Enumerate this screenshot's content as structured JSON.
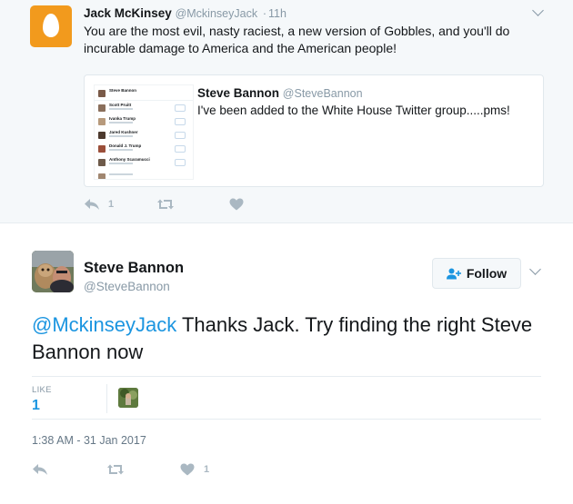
{
  "parent_tweet": {
    "name": "Jack McKinsey",
    "handle": "@MckinseyJack",
    "separator": "·",
    "time": "11h",
    "text": "You are the most evil, nasty raciest, a new version of Gobbles, and you'll do incurable damage to America and the American people!",
    "avatar_color": "#f29a1d",
    "quoted": {
      "name": "Steve Bannon",
      "handle": "@SteveBannon",
      "text": "I've been added to the White House Twitter group.....pms!",
      "thumbnail_rows": [
        {
          "name": "Steve Bannon"
        },
        {
          "name": "Scott Pruitt"
        },
        {
          "name": "Ivanka Trump"
        },
        {
          "name": "Jared Kushner"
        },
        {
          "name": "Donald J. Trump"
        },
        {
          "name": "Anthony Scaramucci"
        }
      ]
    },
    "actions": {
      "reply_icon": "reply-icon",
      "reply_count": "1",
      "retweet_icon": "retweet-icon",
      "like_icon": "heart-icon"
    }
  },
  "main_tweet": {
    "name": "Steve Bannon",
    "handle": "@SteveBannon",
    "follow_label": "Follow",
    "mention": "@MckinseyJack",
    "text": " Thanks Jack. Try finding the right Steve Bannon now",
    "stats": {
      "like_label": "LIKE",
      "like_count": "1"
    },
    "date": "1:38 AM - 31 Jan 2017",
    "actions": {
      "reply_icon": "reply-icon",
      "retweet_icon": "retweet-icon",
      "like_icon": "heart-icon",
      "like_count": "1"
    }
  },
  "colors": {
    "link_blue": "#1b95e0",
    "icon_gray": "#aab8c2",
    "muted_text": "#8899a6",
    "parent_bg": "#f5f8fa"
  }
}
